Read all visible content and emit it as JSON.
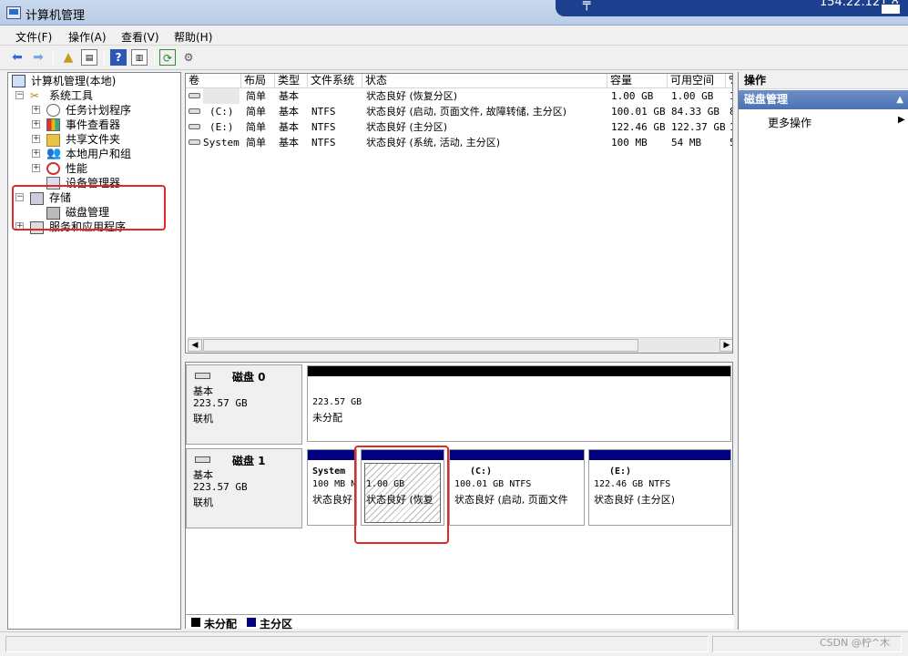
{
  "window": {
    "title": "计算机管理",
    "remote_ip": "154.22.121.8"
  },
  "menu": [
    "文件(F)",
    "操作(A)",
    "查看(V)",
    "帮助(H)"
  ],
  "toolbar": {
    "back_icon": "back-arrow-icon",
    "forward_icon": "forward-arrow-icon"
  },
  "tree": {
    "root": "计算机管理(本地)",
    "system_tools": "系统工具",
    "task_scheduler": "任务计划程序",
    "event_viewer": "事件查看器",
    "shared_folders": "共享文件夹",
    "local_users": "本地用户和组",
    "performance": "性能",
    "device_manager": "设备管理器",
    "storage": "存储",
    "disk_management": "磁盘管理",
    "services_apps": "服务和应用程序"
  },
  "volume_list": {
    "columns": [
      "卷",
      "布局",
      "类型",
      "文件系统",
      "状态",
      "容量",
      "可用空间",
      "%"
    ],
    "rows": [
      {
        "volume": "",
        "layout": "简单",
        "type": "基本",
        "fs": "",
        "status": "状态良好 (恢复分区)",
        "capacity": "1.00 GB",
        "free": "1.00 GB",
        "pct": "1"
      },
      {
        "volume": "(C:)",
        "layout": "简单",
        "type": "基本",
        "fs": "NTFS",
        "status": "状态良好 (启动, 页面文件, 故障转储, 主分区)",
        "capacity": "100.01 GB",
        "free": "84.33 GB",
        "pct": "8"
      },
      {
        "volume": "(E:)",
        "layout": "简单",
        "type": "基本",
        "fs": "NTFS",
        "status": "状态良好 (主分区)",
        "capacity": "122.46 GB",
        "free": "122.37 GB",
        "pct": "1"
      },
      {
        "volume": "System",
        "layout": "简单",
        "type": "基本",
        "fs": "NTFS",
        "status": "状态良好 (系统, 活动, 主分区)",
        "capacity": "100 MB",
        "free": "54 MB",
        "pct": "5"
      }
    ]
  },
  "disks": [
    {
      "name": "磁盘 0",
      "kind": "基本",
      "size": "223.57 GB",
      "state": "联机",
      "unallocated_size": "223.57 GB",
      "unallocated_label": "未分配"
    },
    {
      "name": "磁盘 1",
      "kind": "基本",
      "size": "223.57 GB",
      "state": "联机",
      "partitions": [
        {
          "title": "System",
          "line2": "100 MB N",
          "line3": "状态良好"
        },
        {
          "title": "",
          "line2": "1.00 GB",
          "line3": "状态良好 (恢复"
        },
        {
          "title": "(C:)",
          "line2": "100.01 GB NTFS",
          "line3": "状态良好 (启动, 页面文件"
        },
        {
          "title": "(E:)",
          "line2": "122.46 GB NTFS",
          "line3": "状态良好 (主分区)"
        }
      ]
    }
  ],
  "legend": {
    "unallocated": "未分配",
    "primary": "主分区"
  },
  "actions": {
    "header": "操作",
    "section": "磁盘管理",
    "more": "更多操作"
  },
  "watermark": "CSDN @柠^木",
  "colors": {
    "primary_partition": "#000080",
    "unallocated": "#000000",
    "highlight": "#e02a2a"
  }
}
